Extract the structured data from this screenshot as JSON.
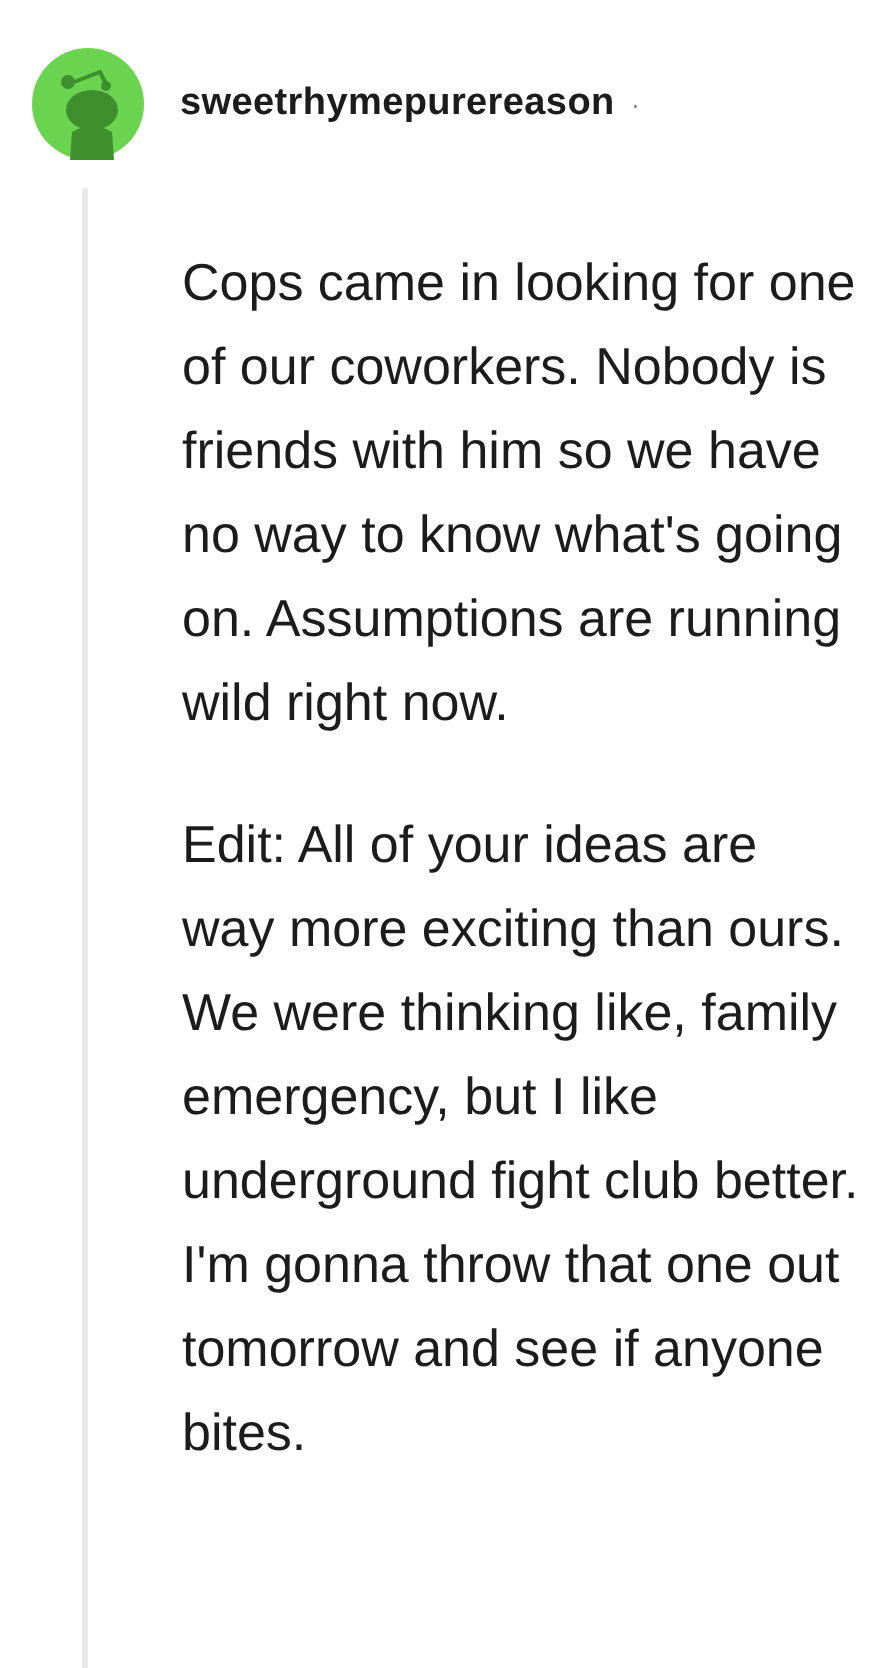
{
  "comment": {
    "author": "sweetrhymepurereason",
    "separator": "·",
    "paragraphs": [
      "Cops came in looking for one of our coworkers. Nobody is friends with him so we have no way to know what's going on. Assumptions are running wild right now.",
      "Edit: All of your ideas are way more exciting than ours. We were thinking like, family emergency, but I like underground fight club better. I'm gonna throw that one out tomorrow and see if anyone bites."
    ]
  }
}
